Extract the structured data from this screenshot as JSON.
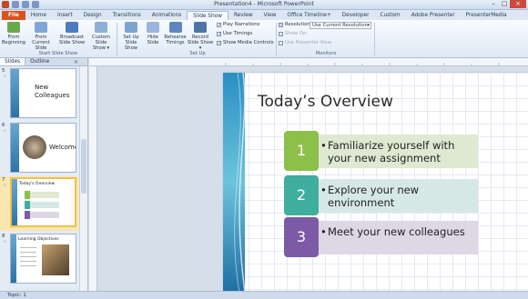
{
  "window": {
    "title": "Presentation4 - Microsoft PowerPoint"
  },
  "ribbon_tabs": [
    "File",
    "Home",
    "Insert",
    "Design",
    "Transitions",
    "Animations",
    "Slide Show",
    "Review",
    "View",
    "Office Timeline+",
    "Developer",
    "Custom",
    "Adobe Presenter",
    "PresenterMedia"
  ],
  "ribbon": {
    "from_beginning": "From Beginning",
    "from_current": "From Current Slide",
    "broadcast": "Broadcast Slide Show",
    "custom_show": "Custom Slide Show ▾",
    "group_start": "Start Slide Show",
    "setup_show": "Set Up Slide Show",
    "hide_slide": "Hide Slide",
    "rehearse": "Rehearse Timings",
    "record": "Record Slide Show ▾",
    "play_narrations": "Play Narrations",
    "use_timings": "Use Timings",
    "show_media": "Show Media Controls",
    "group_setup": "Set Up",
    "resolution_label": "Resolution:",
    "resolution_value": "Use Current Resolution",
    "show_on": "Show On:",
    "presenter_view": "Use Presenter View",
    "group_monitors": "Monitors"
  },
  "panel": {
    "tab_slides": "Slides",
    "tab_outline": "Outline",
    "close": "×",
    "thumbs": [
      {
        "num": "5",
        "title": "New Colleagues"
      },
      {
        "num": "6",
        "title": "Welcome"
      },
      {
        "num": "7",
        "title": "Today's Overview"
      },
      {
        "num": "8",
        "title": "Learning Objectives"
      }
    ]
  },
  "slide": {
    "title": "Today’s Overview",
    "items": [
      {
        "num": "1",
        "text": "Familiarize yourself with your new assignment",
        "color": "#8dc04b",
        "bar": "#dfe9d2"
      },
      {
        "num": "2",
        "text": "Explore your new environment",
        "color": "#3fae9f",
        "bar": "#d6e8e6"
      },
      {
        "num": "3",
        "text": "Meet your new colleagues",
        "color": "#7c5aa6",
        "bar": "#ddd7e6"
      }
    ]
  },
  "status": {
    "text": "Topic: 1"
  }
}
